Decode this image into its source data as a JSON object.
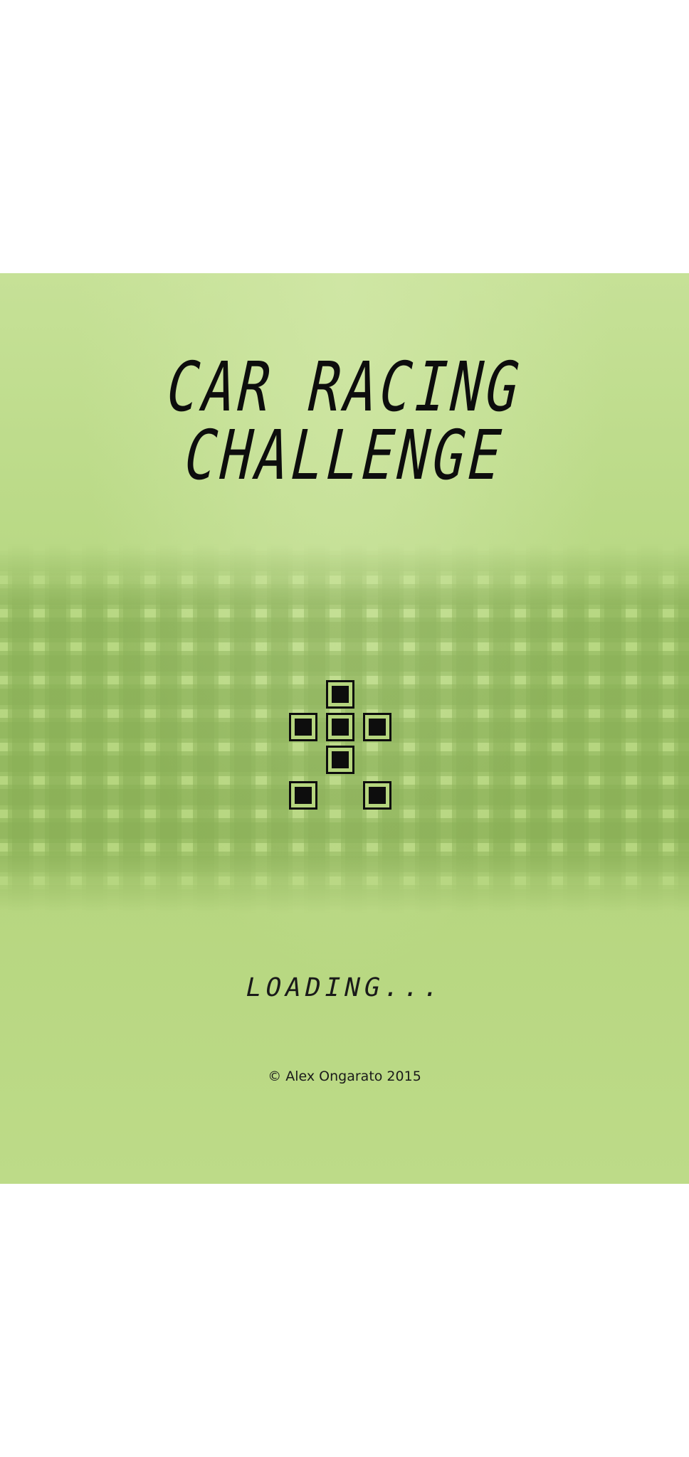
{
  "title": {
    "line1": "CAR RACING",
    "line2": "CHALLENGE"
  },
  "status": {
    "loading": "LOADING..."
  },
  "footer": {
    "copyright": "© Alex Ongarato 2015"
  },
  "colors": {
    "lcd_background": "#b9d985",
    "lcd_foreground": "#0d0d0d",
    "page_background": "#ffffff"
  },
  "sprite": {
    "name": "player-car-icon"
  }
}
